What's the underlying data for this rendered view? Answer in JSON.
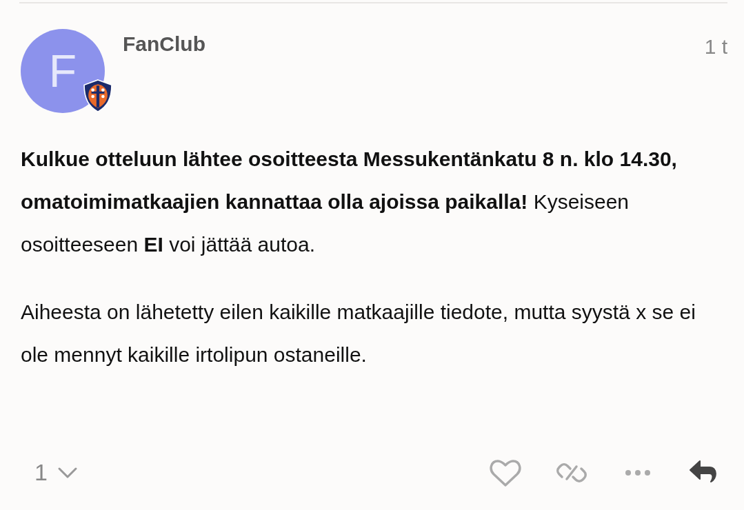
{
  "post": {
    "avatar_letter": "F",
    "username": "FanClub",
    "time": "1 t",
    "paragraphs": [
      "**Kulkue otteluun lähtee osoitteesta Messukentänkatu 8 n. klo 14.30, omatoimimatkaajien kannattaa olla ajoissa paikalla!** Kyseiseen osoitteeseen **EI** voi jättää autoa.",
      "Aiheesta on lähetetty eilen kaikille matkaajille tiedote, mutta syystä x se ei ole mennyt kaikille irtolipun ostaneille."
    ],
    "reply_count": "1"
  }
}
